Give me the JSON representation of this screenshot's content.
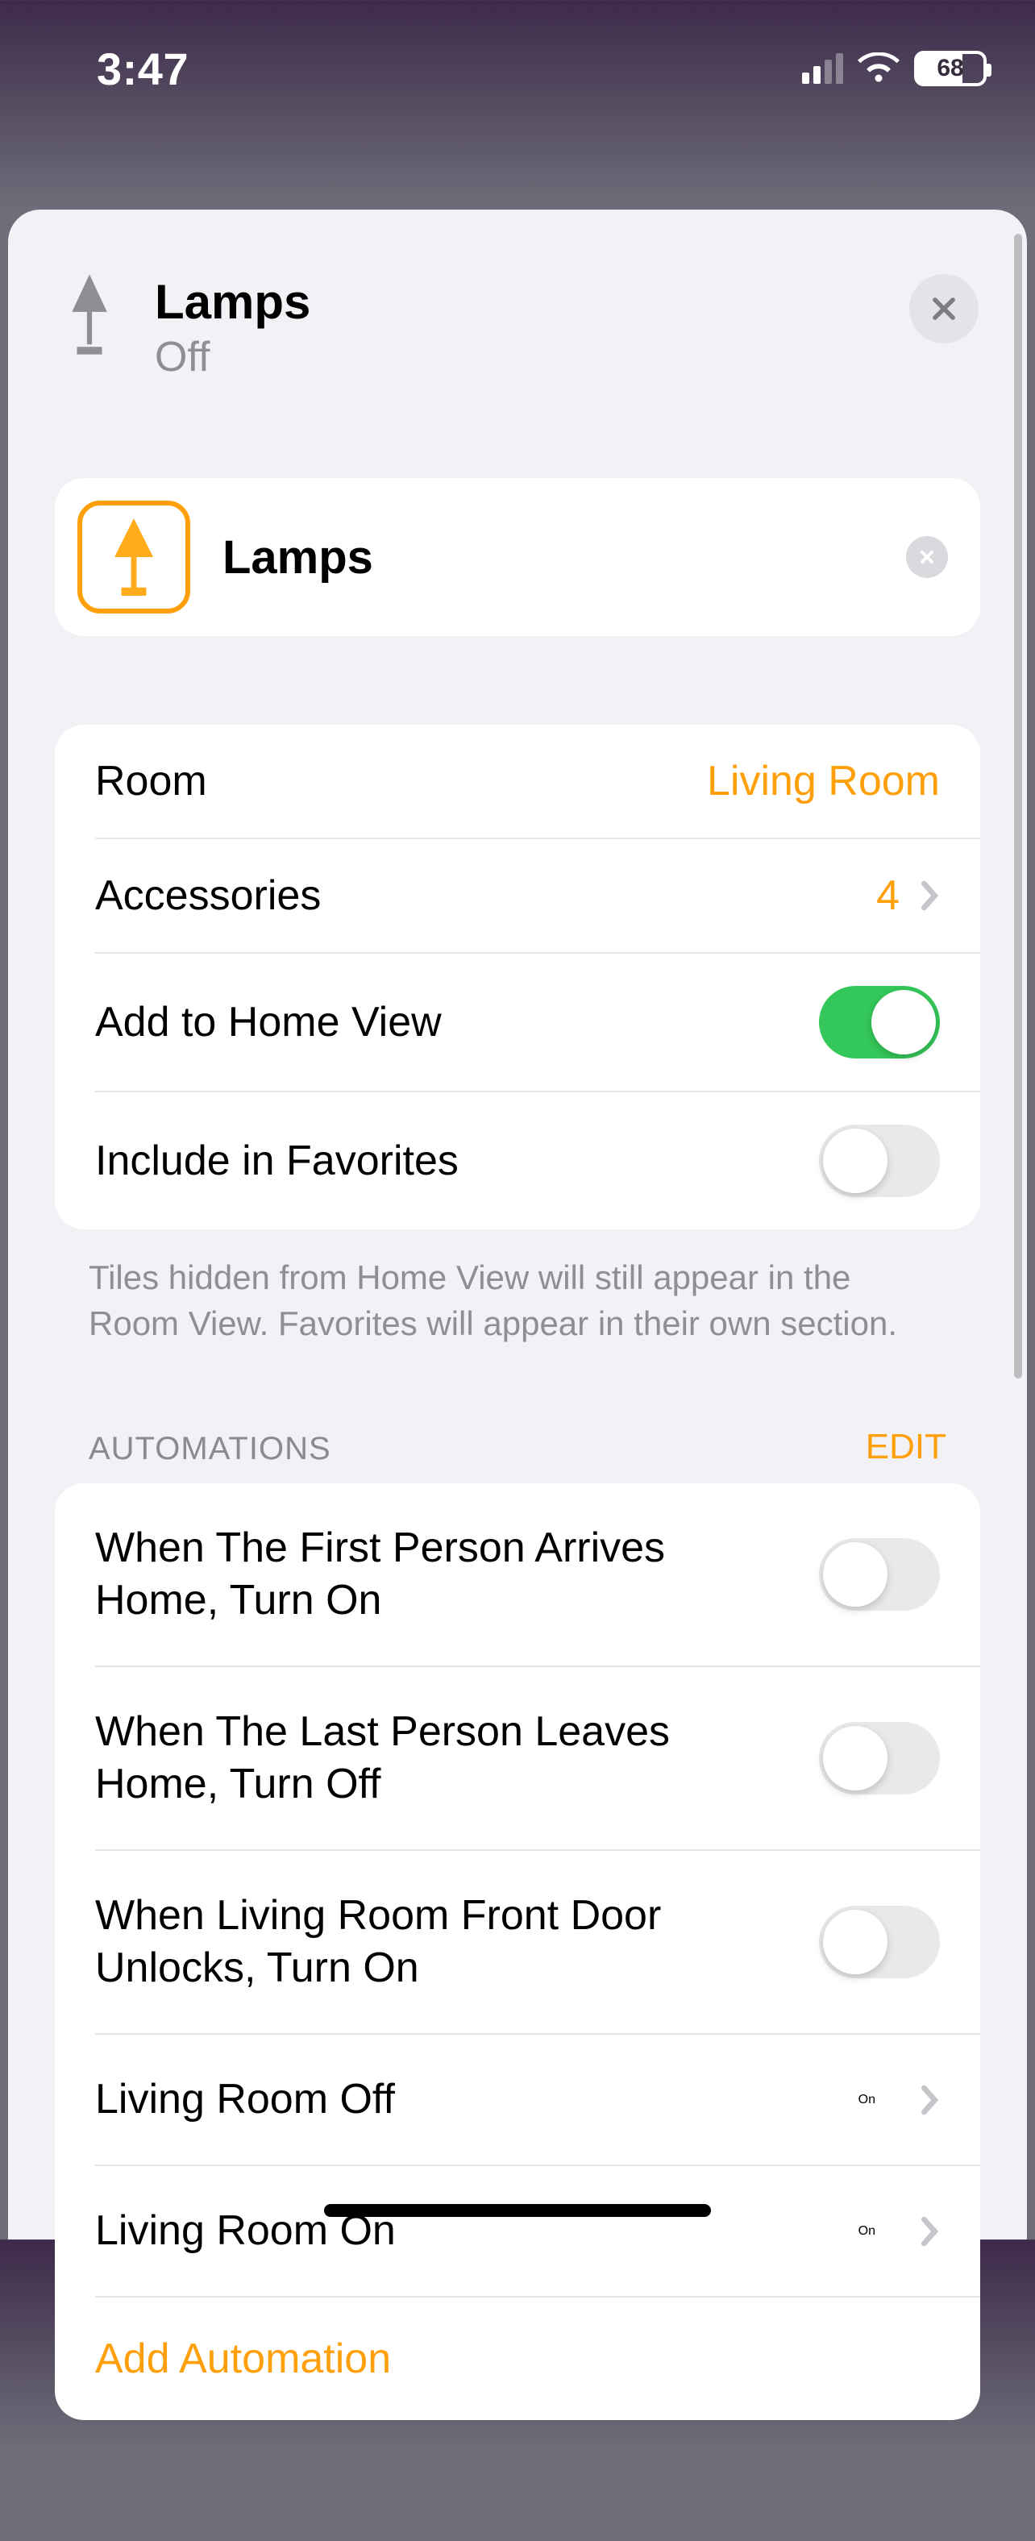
{
  "statusbar": {
    "time": "3:47",
    "battery": "68"
  },
  "header": {
    "title": "Lamps",
    "subtitle": "Off"
  },
  "name_field": {
    "value": "Lamps"
  },
  "settings": {
    "room": {
      "label": "Room",
      "value": "Living Room"
    },
    "accessories": {
      "label": "Accessories",
      "value": "4"
    },
    "homeview": {
      "label": "Add to Home View",
      "on": true
    },
    "favorites": {
      "label": "Include in Favorites",
      "on": false
    },
    "footnote": "Tiles hidden from Home View will still appear in the Room View. Favorites will appear in their own section."
  },
  "automations": {
    "title": "AUTOMATIONS",
    "edit": "EDIT",
    "items": [
      {
        "label": "When The First Person Arrives Home, Turn On",
        "type": "toggle",
        "on": false
      },
      {
        "label": "When The Last Person Leaves Home, Turn Off",
        "type": "toggle",
        "on": false
      },
      {
        "label": "When Living Room Front Door Unlocks, Turn On",
        "type": "toggle",
        "on": false
      },
      {
        "label": "Living Room Off",
        "type": "link",
        "value": "On"
      },
      {
        "label": "Living Room On",
        "type": "link",
        "value": "On"
      }
    ],
    "add": "Add Automation"
  }
}
